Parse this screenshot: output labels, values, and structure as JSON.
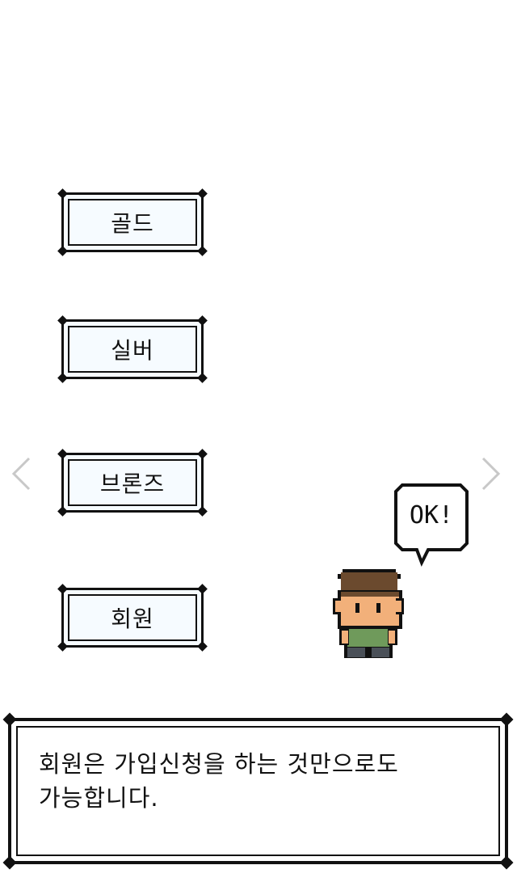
{
  "menu": {
    "items": [
      {
        "label": "골드"
      },
      {
        "label": "실버"
      },
      {
        "label": "브론즈"
      },
      {
        "label": "회원"
      }
    ]
  },
  "speech": {
    "text": "OK!"
  },
  "dialog": {
    "line1": "회원은 가입신청을 하는 것만으로도",
    "line2": "가능합니다."
  },
  "icons": {
    "prev": "chevron-left-icon",
    "next": "chevron-right-icon"
  },
  "colors": {
    "outline": "#111111",
    "button_fill": "#f6fbff",
    "arrow": "#c8c8c8",
    "hair": "#6b4a2e",
    "skin": "#f2b07a",
    "shirt": "#6f9a5b",
    "pants": "#4a5058"
  }
}
